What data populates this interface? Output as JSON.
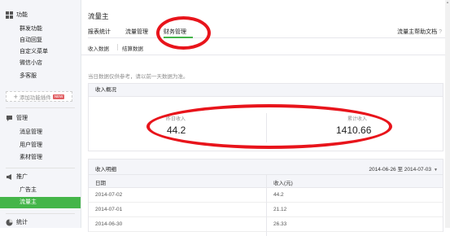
{
  "sidebar": {
    "func_label": "功能",
    "func_items": [
      "群发功能",
      "自动回复",
      "自定义菜单",
      "微信小店",
      "多客服"
    ],
    "add_plugin": "添加功能插件",
    "new_badge": "NEW",
    "manage_label": "管理",
    "manage_items": [
      "消息管理",
      "用户管理",
      "素材管理"
    ],
    "promo_label": "推广",
    "promo_items": [
      "广告主",
      "流量主"
    ],
    "stats_label": "统计"
  },
  "header": {
    "title": "流量主",
    "tabs": [
      "报表统计",
      "流量管理",
      "财务管理"
    ],
    "help": "流量主帮助文档"
  },
  "subtabs": [
    "收入数据",
    "结算数据"
  ],
  "notice": "当日数据仅供参考，请以前一天数据为准。",
  "overview": {
    "title": "收入概况",
    "left_label": "昨日收入",
    "left_value": "44.2",
    "right_label": "累计收入",
    "right_value": "1410.66"
  },
  "detail": {
    "title": "收入明细",
    "date_range": "2014-06-26 至 2014-07-03",
    "columns": [
      "日期",
      "收入(元)"
    ],
    "rows": [
      {
        "date": "2014-07-02",
        "income": "44.2"
      },
      {
        "date": "2014-07-01",
        "income": "21.12"
      },
      {
        "date": "2014-06-30",
        "income": "26.33"
      }
    ]
  },
  "colors": {
    "accent": "#44b549",
    "annotation": "#e8141b",
    "sidebar_bg": "#f4f5f9"
  }
}
